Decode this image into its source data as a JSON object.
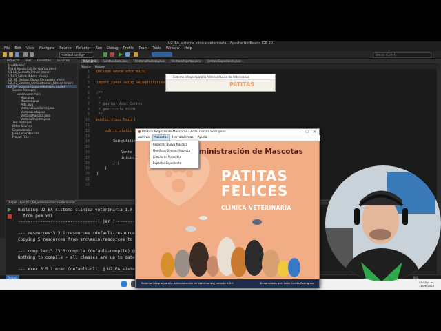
{
  "ide": {
    "window_title": "U2_EA_sistema-clinica-veterinaria - Apache NetBeans IDE 20",
    "menu": [
      "File",
      "Edit",
      "View",
      "Navigate",
      "Source",
      "Refactor",
      "Run",
      "Debug",
      "Profile",
      "Team",
      "Tools",
      "Window",
      "Help"
    ],
    "config_select": "<default config>",
    "search_placeholder": "Search (Ctrl+I)",
    "project_tabs": [
      "Projects",
      "Files",
      "Favorites",
      "Services"
    ],
    "project_tree": [
      "JavaModule1",
      "Flat 8 Mundo Edición Gráfica (dev)",
      "U1-A1_Gomado_Prevell (main)",
      "U1-A2_Solicitud-beca (main)",
      "U2_A2_Gestion_Cobro_Consuelete (main)",
      "U2_A3_Sistema_Administracion_Libreria (main)",
      "U2_EA_sistema-clinica-veterinaria (main)",
      "Source Packages",
      "unadm.adcr.main",
      "Main.java",
      "Mascota.java",
      "Pets.java",
      "VentanaExpediente.java",
      "VentanaLista.java",
      "VentanaMascota.java",
      "VentanaRegistro.java",
      "Test Packages",
      "Other Sources",
      "Dependencies",
      "Java Dependencies",
      "Project Files"
    ],
    "editor_tabs": [
      "Main.java",
      "VentanaLista.java",
      "VentanaMascota.java",
      "VentanaRegistro.java",
      "VentanaExpediente.java"
    ],
    "source_tabs": [
      "Source",
      "History"
    ],
    "code_lines": [
      {
        "n": "1",
        "text": "package unadm.adcr.main;",
        "cls": "kw"
      },
      {
        "n": "2",
        "text": "",
        "cls": "tx"
      },
      {
        "n": "3",
        "text": "import javax.swing.SwingUtilities;",
        "cls": "kw"
      },
      {
        "n": "4",
        "text": "",
        "cls": "tx"
      },
      {
        "n": "5",
        "text": "/**",
        "cls": "cm"
      },
      {
        "n": "6",
        "text": " *",
        "cls": "cm"
      },
      {
        "n": "7",
        "text": " * @author Adán Cortés",
        "cls": "cm"
      },
      {
        "n": "8",
        "text": " * @matricula ES231",
        "cls": "cm"
      },
      {
        "n": "9",
        "text": " */",
        "cls": "cm"
      },
      {
        "n": "10",
        "text": "public class Main {",
        "cls": "kw"
      },
      {
        "n": "11",
        "text": "",
        "cls": "tx"
      },
      {
        "n": "12",
        "text": "    public static vo",
        "cls": "kw"
      },
      {
        "n": "13",
        "text": "",
        "cls": "tx"
      },
      {
        "n": "14",
        "text": "        SwingUtilitie",
        "cls": "tx"
      },
      {
        "n": "15",
        "text": "",
        "cls": "tx"
      },
      {
        "n": "16",
        "text": "            Vente",
        "cls": "tx"
      },
      {
        "n": "17",
        "text": "            inicio.",
        "cls": "tx"
      },
      {
        "n": "18",
        "text": "        });",
        "cls": "tx"
      },
      {
        "n": "19",
        "text": "    }",
        "cls": "tx"
      },
      {
        "n": "20",
        "text": "}",
        "cls": "tx"
      },
      {
        "n": "21",
        "text": "",
        "cls": "tx"
      },
      {
        "n": "22",
        "text": "",
        "cls": "tx"
      }
    ],
    "output_title": "Output - Run (U2_EA_sistema-clinica-veterinaria)",
    "output_lines": [
      "Building U2_EA_sistema-clinica-veterinaria 1.0-SNAPS",
      "  from pom.xml",
      "--------------------------------[ jar ]------------",
      "",
      "--- resources:3.3.1:resources (default-resources) @",
      "Copying 5 resources from src\\main\\resources to targ",
      "",
      "--- compiler:3.13.0:compile (default-compile) @ U2_EA_sistema-clinica-veterinaria ---",
      "Nothing to compile - all classes are up to date.",
      "",
      "--- exec:3.5.1:exec (default-cli) @ U2_EA_sistema-clinica-veterinaria ---"
    ],
    "status_text": "Run (U2_EA_sistema-clinica-veterinaria)",
    "status_right": "INS",
    "clock_time": "03:03 p. m.",
    "clock_date": "14/06/2024"
  },
  "bg_window": {
    "title": "Sistema Integral para la Administración de Veterinarias",
    "brand": "PATITAS"
  },
  "app": {
    "title": "Módulo Registro de Mascotas - Adán Cortés Rodríguez",
    "menu": [
      "Archivo",
      "Mascotas",
      "Herramientas",
      "Ayuda"
    ],
    "dropdown": [
      "Registrar Nueva Mascota",
      "Modificar/Eliminar Mascota",
      "Listado de Mascotas",
      "Exportar Expediente"
    ],
    "heading": "Administración de Mascotas",
    "brand_line1": "PATITAS",
    "brand_line2": "FELICES",
    "brand_line3": "CLÍNICA VETERINARIA",
    "footer_left": "Sistema Integral para la Administración de Veterinarias | versión 1.0.0",
    "footer_right": "Desarrollado por: Adán Cortés Rodríguez",
    "colors": {
      "background": "#f1ad85",
      "footer": "#1f2b4a",
      "heading": "#5a1e17"
    }
  }
}
